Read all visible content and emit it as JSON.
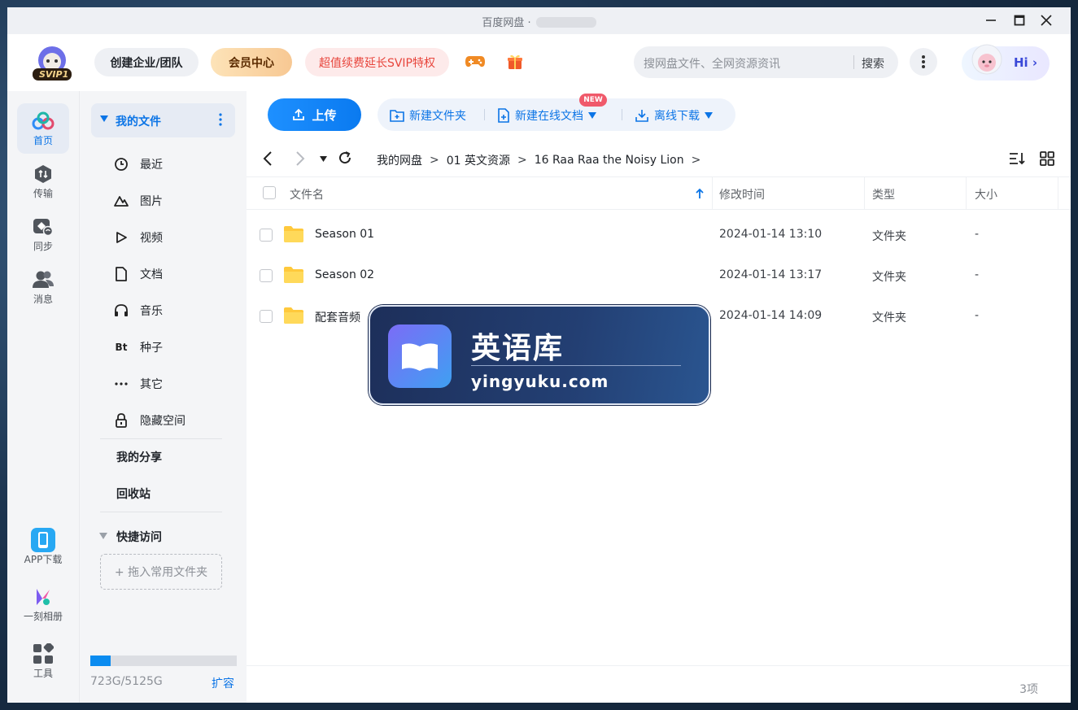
{
  "window": {
    "title": "百度网盘 ·"
  },
  "header": {
    "logo_badge": "SVIP1",
    "team_label": "创建企业/团队",
    "vip_label": "会员中心",
    "svip_label": "超值续费延长SVIP特权",
    "game_icon": "gamepad-icon",
    "gift_icon": "gift-icon",
    "search_placeholder": "搜网盘文件、全网资源资讯",
    "search_button": "搜索",
    "hi_label": "Hi"
  },
  "rail": {
    "items": [
      {
        "label": "首页",
        "icon": "home-cloud-icon",
        "active": true
      },
      {
        "label": "传输",
        "icon": "transfer-icon"
      },
      {
        "label": "同步",
        "icon": "sync-icon"
      },
      {
        "label": "消息",
        "icon": "message-icon"
      }
    ],
    "bottom": [
      {
        "label": "APP下载",
        "icon": "phone-icon"
      },
      {
        "label": "一刻相册",
        "icon": "album-icon"
      },
      {
        "label": "工具",
        "icon": "tools-icon"
      }
    ]
  },
  "sidebar": {
    "my_files": "我的文件",
    "items": [
      {
        "label": "最近",
        "icon": "clock-icon"
      },
      {
        "label": "图片",
        "icon": "image-icon"
      },
      {
        "label": "视频",
        "icon": "play-icon"
      },
      {
        "label": "文档",
        "icon": "document-icon"
      },
      {
        "label": "音乐",
        "icon": "headphones-icon"
      },
      {
        "label": "种子",
        "icon": "bt-icon"
      },
      {
        "label": "其它",
        "icon": "more-dots-icon"
      },
      {
        "label": "隐藏空间",
        "icon": "lock-icon"
      }
    ],
    "share": "我的分享",
    "recycle": "回收站",
    "quick_access": "快捷访问",
    "quick_add": "+ 拖入常用文件夹",
    "quota_text": "723G/5125G",
    "quota_used_fraction": 0.141,
    "expand": "扩容"
  },
  "toolbar": {
    "upload": "上传",
    "new_folder": "新建文件夹",
    "new_doc": "新建在线文档",
    "new_badge": "NEW",
    "offline": "离线下载"
  },
  "breadcrumb": [
    "我的网盘",
    "01 英文资源",
    "16 Raa Raa the Noisy Lion"
  ],
  "table": {
    "columns": [
      "文件名",
      "修改时间",
      "类型",
      "大小"
    ],
    "rows": [
      {
        "name": "Season 01",
        "time": "2024-01-14 13:10",
        "type": "文件夹",
        "size": "-"
      },
      {
        "name": "Season 02",
        "time": "2024-01-14 13:17",
        "type": "文件夹",
        "size": "-"
      },
      {
        "name": "配套音频",
        "time": "2024-01-14 14:09",
        "type": "文件夹",
        "size": "-"
      }
    ],
    "count": "3项"
  },
  "watermark": {
    "title": "英语库",
    "url": "yingyuku.com"
  },
  "colors": {
    "accent": "#0b74e6",
    "svip_red": "#e8453c",
    "folder": "#ffc93c"
  }
}
